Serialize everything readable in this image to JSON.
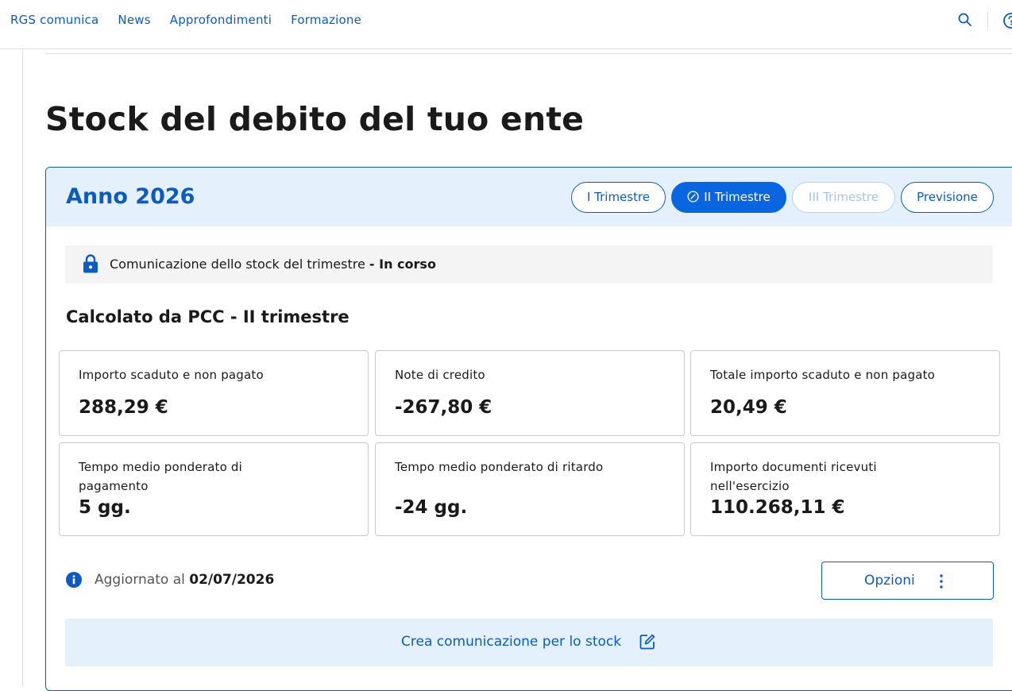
{
  "nav": {
    "items": [
      "RGS comunica",
      "News",
      "Approfondimenti",
      "Formazione"
    ],
    "search_icon": "search-icon",
    "help_icon": "help-icon"
  },
  "page": {
    "title": "Stock del debito del tuo ente"
  },
  "card": {
    "year_label": "Anno 2026",
    "tabs": [
      {
        "label": "I Trimestre",
        "state": "default"
      },
      {
        "label": "II Trimestre",
        "state": "active",
        "icon": "edit-circle-icon"
      },
      {
        "label": "III Trimestre",
        "state": "disabled"
      },
      {
        "label": "Previsione",
        "state": "default"
      }
    ],
    "status": {
      "icon": "lock-icon",
      "text": "Comunicazione dello stock del trimestre",
      "state": "- In corso"
    },
    "section_title": "Calcolato da PCC - II trimestre",
    "metrics": [
      {
        "label": "Importo scaduto e non pagato",
        "value": "288,29 €"
      },
      {
        "label": "Note di credito",
        "value": "-267,80 €"
      },
      {
        "label": "Totale importo scaduto e non pagato",
        "value": "20,49 €"
      },
      {
        "label": "Tempo medio ponderato di pagamento",
        "value": "5 gg."
      },
      {
        "label": "Tempo medio ponderato di ritardo",
        "value": "-24 gg."
      },
      {
        "label": "Importo documenti ricevuti nell'esercizio",
        "value": "110.268,11 €"
      }
    ],
    "updated": {
      "icon": "info-icon",
      "label": "Aggiornato al",
      "date": "02/07/2026"
    },
    "options_button": {
      "label": "Opzioni",
      "icon": "kebab-menu-icon"
    },
    "create_button": {
      "label": "Crea comunicazione per lo stock",
      "icon": "edit-icon"
    }
  },
  "colors": {
    "primary": "#0a5cc2",
    "primary_active": "#0a66e0",
    "header_bg": "#e5f0fd",
    "status_bg": "#f4f4f5",
    "border": "#c7cbd1"
  }
}
